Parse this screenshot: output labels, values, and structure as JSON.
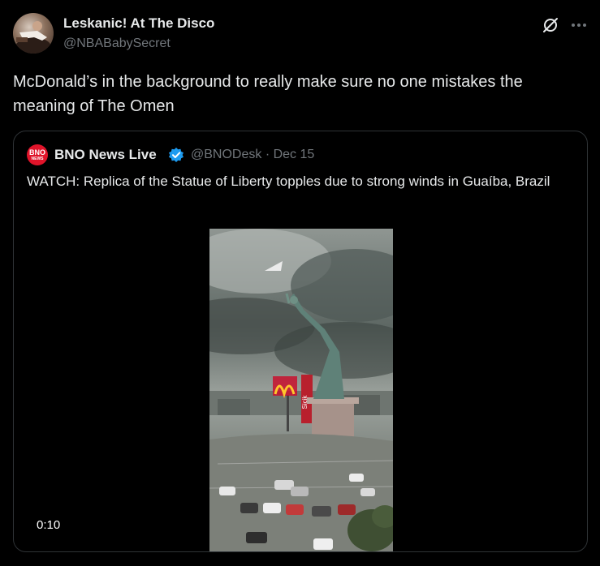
{
  "post": {
    "author_name": "Leskanic! At The Disco",
    "author_handle": "@NBABabySecret",
    "text": "McDonald’s in the background to really make sure no one mistakes the meaning of The Omen",
    "icons": [
      "grok-icon",
      "more-icon"
    ]
  },
  "quote": {
    "avatar_line1": "BNO",
    "avatar_line2": "NEWS",
    "author_name": "BNO News Live",
    "handle_date": "@BNODesk · Dec 15",
    "text": "WATCH: Replica of the Statue of Liberty topples due to strong winds in Guaíba, Brazil",
    "video": {
      "timestamp": "0:10",
      "sign_text": "Sicik"
    }
  },
  "colors": {
    "background": "#000000",
    "text": "#e7e9ea",
    "secondary": "#71767b",
    "border": "#2f3336",
    "verified": "#1d9bf0",
    "bno_red": "#e0142a"
  }
}
